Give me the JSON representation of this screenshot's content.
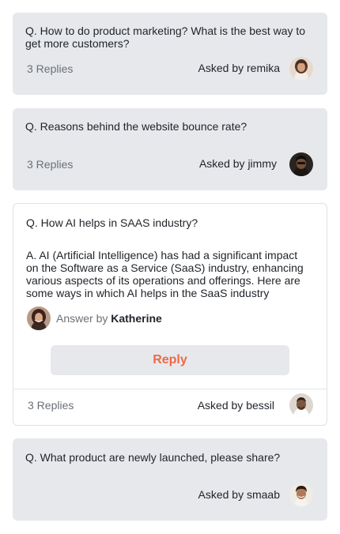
{
  "threads": [
    {
      "question": "Q. How to do product marketing? What is the best way to get more customers?",
      "replies": "3 Replies",
      "asked_by": "Asked by remika",
      "avatar_icon": "user-avatar-remika"
    },
    {
      "question": "Q. Reasons behind the website bounce rate?",
      "replies": "3 Replies",
      "asked_by": "Asked by jimmy",
      "avatar_icon": "user-avatar-jimmy"
    },
    {
      "question": "Q. How AI helps in SAAS industry?",
      "answer": "A. AI (Artificial Intelligence) has had a significant impact on the Software as a Service (SaaS) industry, enhancing various aspects of its operations and offerings. Here are some ways in which AI helps in the SaaS industry",
      "answer_by_prefix": "Answer by",
      "answer_by_name": "Katherine",
      "reply_label": "Reply",
      "replies": "3 Replies",
      "asked_by": "Asked by bessil",
      "avatar_icon": "user-avatar-bessil"
    },
    {
      "question": "Q. What product are newly launched, please share?",
      "asked_by": "Asked by smaab",
      "avatar_icon": "user-avatar-smaab"
    }
  ],
  "colors": {
    "card_gray": "#e6e8ec",
    "reply_accent": "#ee6a44"
  }
}
